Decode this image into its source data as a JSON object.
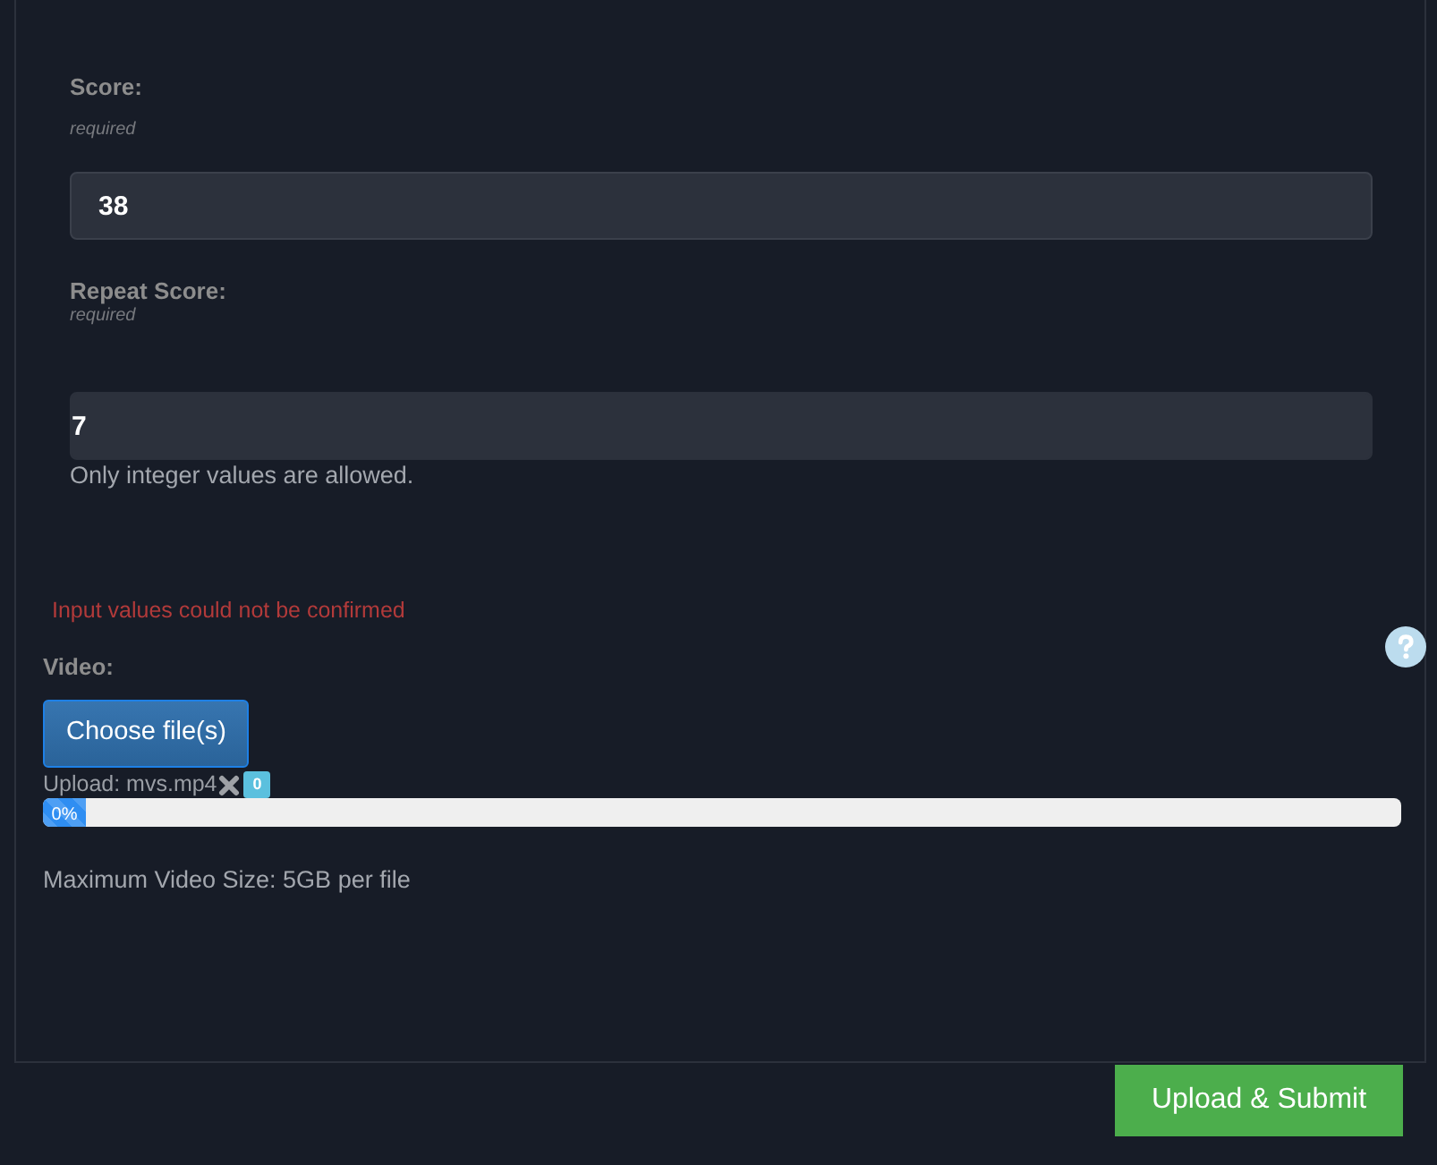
{
  "fields": [
    {
      "label": "Score:",
      "note": "required",
      "value": "38"
    },
    {
      "label": "Repeat Score:",
      "note": "required",
      "value": "7",
      "hint": "Only integer values are allowed."
    }
  ],
  "error": "Input values could not be confirmed",
  "video": {
    "label": "Video:",
    "button": "Choose file(s)",
    "upload": {
      "text": "Upload: mvs.mp4",
      "count": "0"
    },
    "progress": {
      "level": 0,
      "reading": "0%"
    },
    "limit": "Maximum Video Size: 5GB per file"
  },
  "submit": "Upload & Submit"
}
